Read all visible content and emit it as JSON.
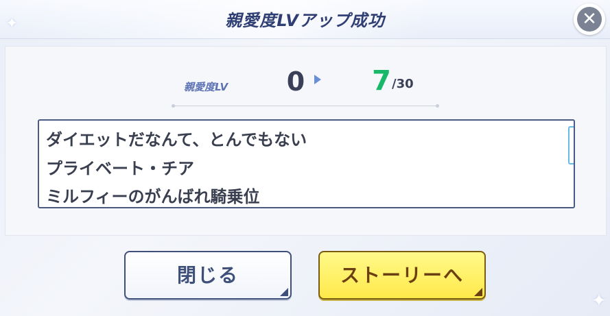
{
  "dialog": {
    "title": "親愛度LVアップ成功",
    "close_icon": "close-icon"
  },
  "level": {
    "label": "親愛度LV",
    "from": "0",
    "to": "7",
    "max": "/30"
  },
  "stories": [
    "ダイエットだなんて、とんでもない",
    "プライベート・チア",
    "ミルフィーのがんばれ騎乗位"
  ],
  "buttons": {
    "close_label": "閉じる",
    "story_label": "ストーリーへ"
  },
  "colors": {
    "title": "#2f3f73",
    "level_to": "#18b86a",
    "story_button": "#ffe94a"
  }
}
